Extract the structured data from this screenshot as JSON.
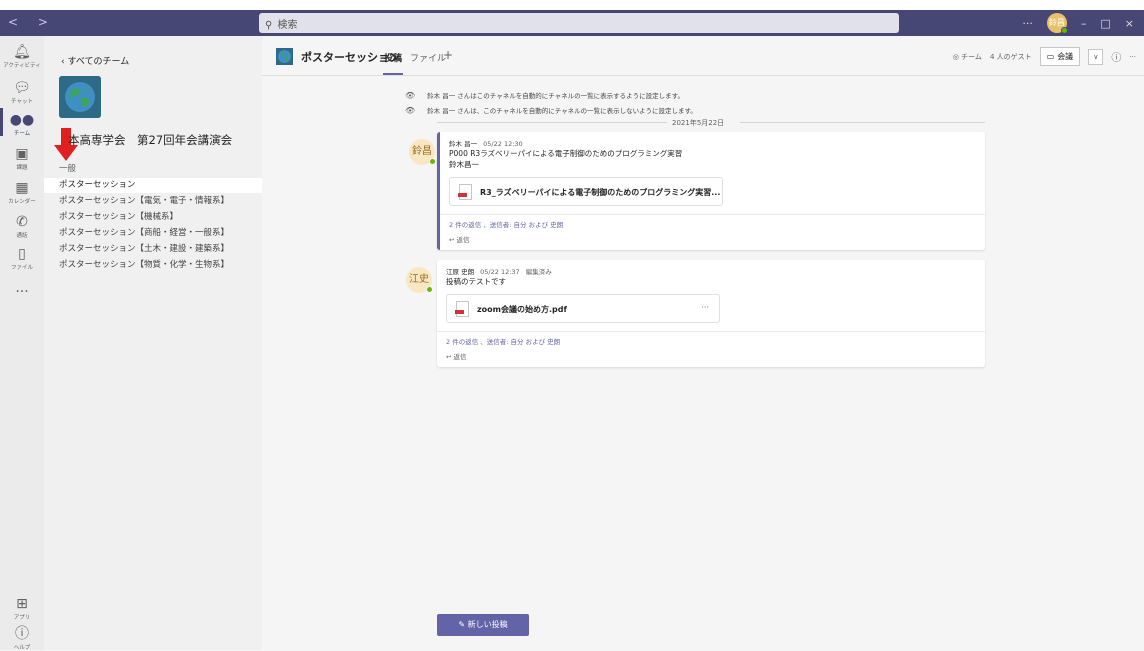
{
  "titlebar": {
    "nav": "< >",
    "search_placeholder": "検索",
    "more": "···",
    "avatar_initials": "鈴昌",
    "minimize": "–",
    "maximize": "□",
    "close": "×"
  },
  "rail": {
    "items": [
      {
        "label": "アクティビティ",
        "icon": "bell-icon",
        "glyph": "🔔"
      },
      {
        "label": "チャット",
        "icon": "chat-icon",
        "glyph": "💬"
      },
      {
        "label": "チーム",
        "icon": "teams-icon",
        "glyph": "👥"
      },
      {
        "label": "課題",
        "icon": "assignments-icon",
        "glyph": "🎒"
      },
      {
        "label": "カレンダー",
        "icon": "calendar-icon",
        "glyph": "📅"
      },
      {
        "label": "通話",
        "icon": "phone-icon",
        "glyph": "📞"
      },
      {
        "label": "ファイル",
        "icon": "file-icon",
        "glyph": "📄"
      },
      {
        "label": "",
        "icon": "more-icon",
        "glyph": "···"
      },
      {
        "label": "アプリ",
        "icon": "apps-icon",
        "glyph": "⊞"
      },
      {
        "label": "ヘルプ",
        "icon": "help-icon",
        "glyph": "?"
      }
    ]
  },
  "sidebar": {
    "back_label": "すべてのチーム",
    "team_name": "本高専学会　第27回年会講演会",
    "team_more": "···",
    "channels": [
      {
        "label": "一般",
        "selected": false
      },
      {
        "label": "ポスターセッション",
        "selected": true
      },
      {
        "label": "ポスターセッション【電気・電子・情報系】",
        "selected": false
      },
      {
        "label": "ポスターセッション【機械系】",
        "selected": false
      },
      {
        "label": "ポスターセッション【商船・経営・一般系】",
        "selected": false
      },
      {
        "label": "ポスターセッション【土木・建設・建築系】",
        "selected": false
      },
      {
        "label": "ポスターセッション【物質・化学・生物系】",
        "selected": false
      }
    ]
  },
  "header": {
    "channel_title": "ポスターセッション",
    "tabs": [
      "投稿",
      "ファイル",
      "+"
    ],
    "team_label": "チーム",
    "guests_label": "4 人のゲスト",
    "meet_label": "会議",
    "meet_dropdown": "∨",
    "info": "ⓘ",
    "more": "···"
  },
  "system_messages": [
    "鈴木 昌一 さんはこのチャネルを自動的にチャネルの一覧に表示するように設定します。",
    "鈴木 昌一 さんは、このチャネルを自動的にチャネルの一覧に表示しないように設定します。"
  ],
  "date_divider": "2021年5月22日",
  "posts": [
    {
      "avatar": "鈴昌",
      "author": "鈴木 昌一",
      "time": "05/22 12:30",
      "edited": "",
      "lines": [
        "P000 R3ラズベリーパイによる電子制御のためのプログラミング実習",
        "鈴木昌一"
      ],
      "attachment": "R3_ラズベリーパイによる電子制御のためのプログラミング実習...",
      "replies": "2 件の返信 、送信者: 自分 および 史朗",
      "reply_label": "返信"
    },
    {
      "avatar": "江史",
      "author": "江原 史朗",
      "time": "05/22 12:37",
      "edited": "編集済み",
      "lines": [
        "投稿のテストです"
      ],
      "attachment": "zoom会議の始め方.pdf",
      "replies": "2 件の返信 、送信者: 自分 および 史朗",
      "reply_label": "返信"
    }
  ],
  "new_post_label": "新しい投稿",
  "colors": {
    "accent": "#6264a7",
    "titlebar": "#464775",
    "presence": "#6bb700"
  }
}
